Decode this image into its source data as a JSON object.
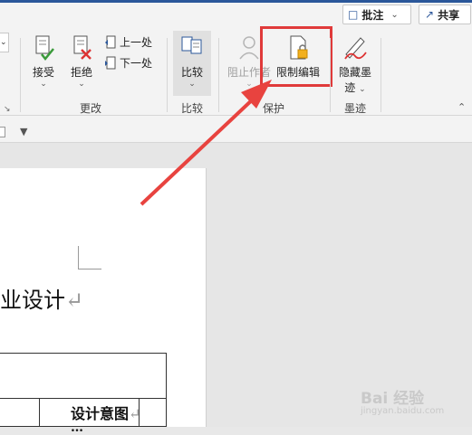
{
  "header": {
    "comments_label": "批注",
    "share_label": "共享"
  },
  "ribbon": {
    "accept_label": "接受",
    "reject_label": "拒绝",
    "previous_label": "上一处",
    "next_label": "下一处",
    "group_changes": "更改",
    "compare_label": "比较",
    "group_compare": "比较",
    "block_authors_label": "阻止作者",
    "restrict_editing_label": "限制编辑",
    "group_protect": "保护",
    "hide_ink_label": "隐藏墨",
    "hide_ink_label2": "迹",
    "group_ink": "墨迹"
  },
  "document": {
    "title_fragment": "业设计",
    "paragraph_mark": "↵",
    "table_cell_text": "设计意图",
    "table_cell_text2": "…",
    "watermark": "Bai 经验",
    "watermark_sub": "jingyan.baidu.com"
  },
  "colors": {
    "accent_blue": "#2b579a",
    "highlight_red": "#e03a3a",
    "arrow_red": "#e8433f"
  }
}
